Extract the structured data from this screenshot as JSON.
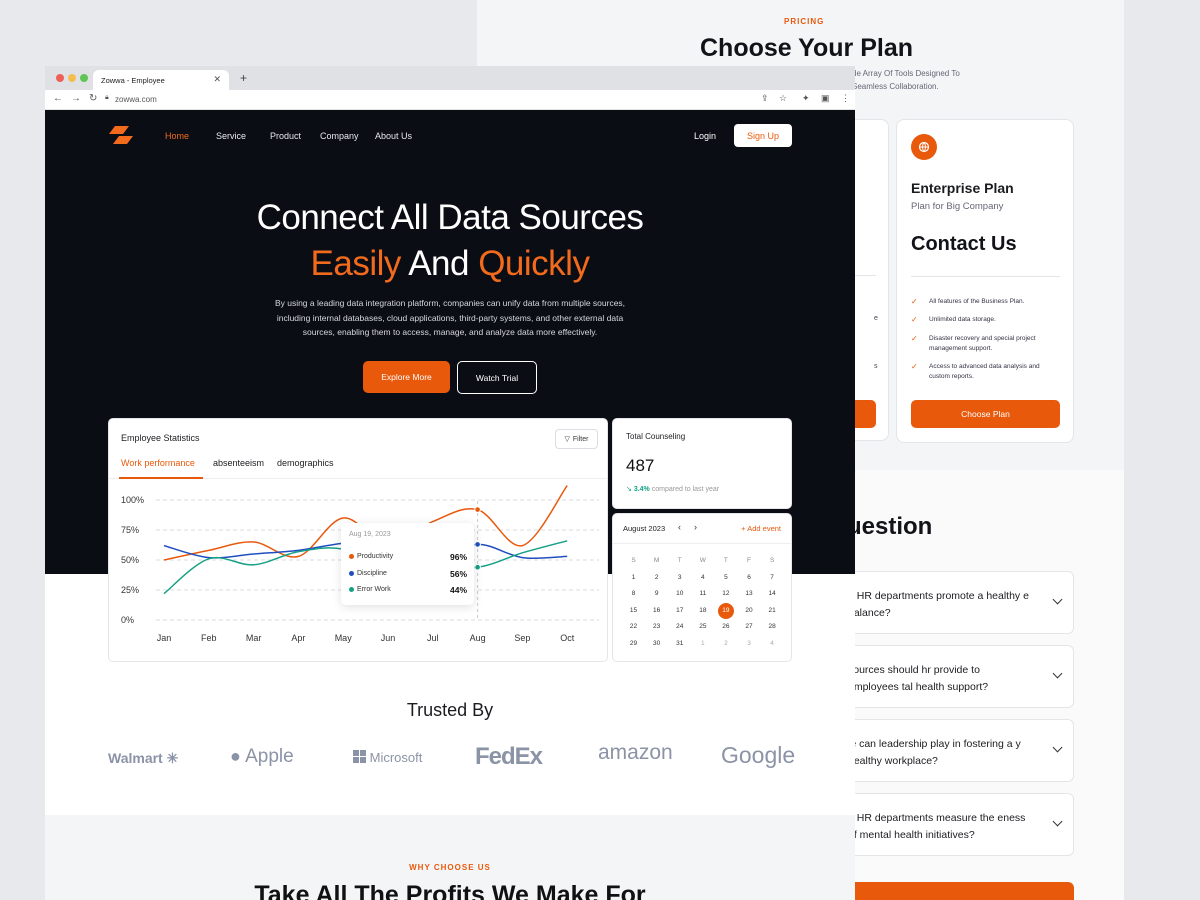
{
  "pricing": {
    "eyebrow": "PRICING",
    "title": "Choose Your Plan",
    "subtitle": "de Array Of Tools Designed To Seamless Collaboration.",
    "left_card_fragments": [
      "e",
      "s"
    ],
    "enterprise": {
      "title": "Enterprise Plan",
      "subtitle": "Plan for Big Company",
      "price": "Contact Us",
      "features": [
        "All features of the Business Plan.",
        "Unlimited data storage.",
        "Disaster recovery and special project management support.",
        "Access to advanced data analysis and custom reports."
      ],
      "button": "Choose Plan"
    }
  },
  "faq": {
    "title": "uestion",
    "items": [
      "n HR departments promote a healthy e balance?",
      "sources should hr provide to employees tal health support?",
      "le can leadership play in fostering a y healthy workplace?",
      "n HR departments measure the eness of mental health initiatives?"
    ]
  },
  "browser": {
    "tab_title": "Zowwa - Employee",
    "url": "zowwa.com"
  },
  "nav": {
    "items": [
      "Home",
      "Service",
      "Product",
      "Company",
      "About Us"
    ],
    "login": "Login",
    "signup": "Sign Up"
  },
  "hero": {
    "line1": "Connect All Data Sources",
    "line2_a": "Easily",
    "line2_b": " And ",
    "line2_c": "Quickly",
    "paragraph": "By using a leading data integration platform, companies can unify data from multiple sources, including internal databases, cloud applications, third-party systems, and other external data sources, enabling them to access, manage, and analyze data more effectively.",
    "explore": "Explore More",
    "watch": "Watch Trial"
  },
  "stats": {
    "title": "Employee Statistics",
    "filter": "Filter",
    "tabs": [
      "Work performance",
      "absenteeism",
      "demographics"
    ],
    "tooltip": {
      "date": "Aug 19, 2023",
      "rows": [
        {
          "label": "Productivity",
          "value": "96%",
          "color": "#e8590c"
        },
        {
          "label": "Discipline",
          "value": "56%",
          "color": "#1f4fbf"
        },
        {
          "label": "Error Work",
          "value": "44%",
          "color": "#16a085"
        }
      ]
    }
  },
  "chart_data": {
    "type": "line",
    "x": [
      "Jan",
      "Feb",
      "Mar",
      "Apr",
      "May",
      "Jun",
      "Jul",
      "Aug",
      "Sep",
      "Oct"
    ],
    "yticks": [
      "100%",
      "75%",
      "50%",
      "25%",
      "0%"
    ],
    "ylim": [
      0,
      100
    ],
    "series": [
      {
        "name": "Productivity",
        "color": "#e8590c",
        "values": [
          50,
          58,
          65,
          53,
          85,
          62,
          82,
          92,
          62,
          112
        ]
      },
      {
        "name": "Discipline",
        "color": "#1f4fbf",
        "values": [
          62,
          52,
          55,
          58,
          64,
          66,
          50,
          63,
          52,
          53
        ]
      },
      {
        "name": "Error Work",
        "color": "#16a085",
        "values": [
          22,
          51,
          46,
          57,
          59,
          42,
          47,
          44,
          56,
          66
        ]
      }
    ]
  },
  "counseling": {
    "title": "Total Counseling",
    "value": "487",
    "change": "3.4%",
    "compare": "compared to last year"
  },
  "calendar": {
    "month": "August 2023",
    "add": "+ Add event",
    "weekdays": [
      "S",
      "M",
      "T",
      "W",
      "T",
      "F",
      "S"
    ],
    "weeks": [
      [
        "1",
        "2",
        "3",
        "4",
        "5",
        "6",
        "7"
      ],
      [
        "8",
        "9",
        "10",
        "11",
        "12",
        "13",
        "14"
      ],
      [
        "15",
        "16",
        "17",
        "18",
        "19",
        "20",
        "21"
      ],
      [
        "22",
        "23",
        "24",
        "25",
        "26",
        "27",
        "28"
      ],
      [
        "29",
        "30",
        "31",
        "1",
        "2",
        "3",
        "4"
      ]
    ],
    "selected": "19"
  },
  "trusted": {
    "title": "Trusted By",
    "brands": [
      "Walmart",
      "Apple",
      "Microsoft",
      "FedEx",
      "amazon",
      "Google"
    ]
  },
  "why": {
    "eyebrow": "WHY CHOOSE US",
    "title": "Take All The Profits We Make For"
  }
}
